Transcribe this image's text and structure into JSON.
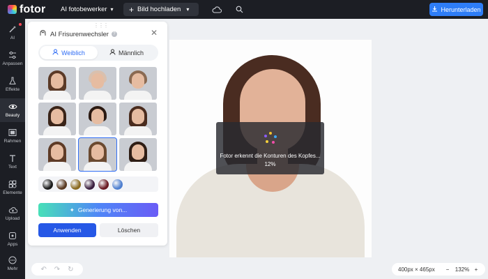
{
  "topbar": {
    "logo_text": "fotor",
    "editor_label": "AI fotobewerker",
    "upload_label": "Bild hochladen",
    "download_label": "Herunterladen"
  },
  "rail": {
    "items": [
      {
        "label": "AI",
        "icon": "magic-wand-icon"
      },
      {
        "label": "Anpassen",
        "icon": "sliders-icon"
      },
      {
        "label": "Effekte",
        "icon": "flask-icon"
      },
      {
        "label": "Beauty",
        "icon": "eye-icon"
      },
      {
        "label": "Rahmen",
        "icon": "frame-icon"
      },
      {
        "label": "Text",
        "icon": "text-icon"
      },
      {
        "label": "Elemente",
        "icon": "shapes-icon"
      },
      {
        "label": "Upload",
        "icon": "cloud-upload-icon"
      },
      {
        "label": "Apps",
        "icon": "apps-icon"
      },
      {
        "label": "Mehr",
        "icon": "more-icon"
      }
    ]
  },
  "panel": {
    "title": "AI Frisurenwechsler",
    "tab_female": "Weiblich",
    "tab_male": "Männlich",
    "generate_label": "Generierung von...",
    "apply_label": "Anwenden",
    "delete_label": "Löschen",
    "hair_colors": [
      "#1a1a1a",
      "#5a3a22",
      "#8a6a20",
      "#3b1f3f",
      "#6a1a22",
      "#4e7fcf"
    ]
  },
  "overlay": {
    "message": "Fotor erkennt die Konturen des Kopfes...",
    "progress": "12%"
  },
  "zoom": {
    "size": "400px × 465px",
    "minus": "−",
    "value": "132%",
    "plus": "+"
  },
  "colors": {
    "accent": "#2e7df6",
    "dark": "#1c1e24"
  }
}
